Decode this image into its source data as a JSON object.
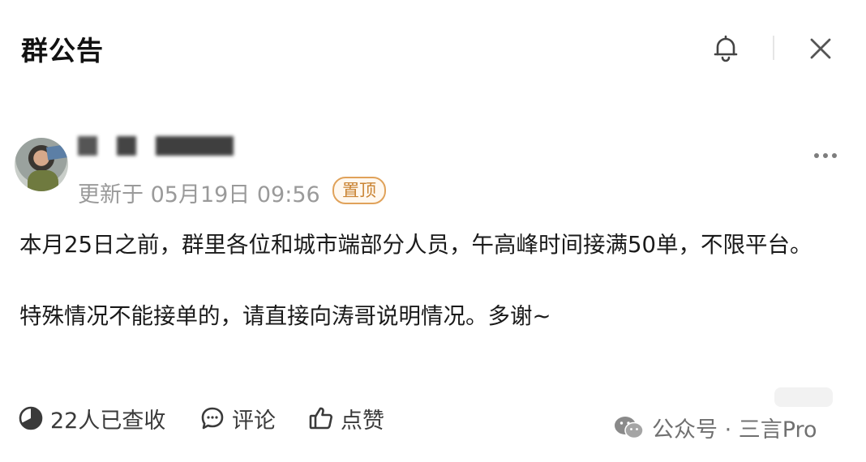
{
  "header": {
    "title": "群公告",
    "bell_icon": "bell-icon",
    "close_icon": "close-icon"
  },
  "post": {
    "avatar": "user-avatar",
    "meta": "更新于 05月19日 09:56",
    "pin_badge": "置顶",
    "more_icon": "more-dots-icon",
    "paragraphs": [
      "本月25日之前，群里各位和城市端部分人员，午高峰时间接满50单，不限平台。",
      "特殊情况不能接单的，请直接向涛哥说明情况。多谢~"
    ]
  },
  "footer": {
    "read_count": "22人已查收",
    "comment_label": "评论",
    "like_label": "点赞",
    "read_icon": "pie-progress-icon",
    "comment_icon": "comment-bubble-icon",
    "like_icon": "thumbs-up-icon"
  },
  "watermark": {
    "text": "公众号 · 三言Pro"
  },
  "colors": {
    "badge": "#e0a25a",
    "meta_text": "#9a9a9a",
    "body_text": "#1a1a1a"
  }
}
